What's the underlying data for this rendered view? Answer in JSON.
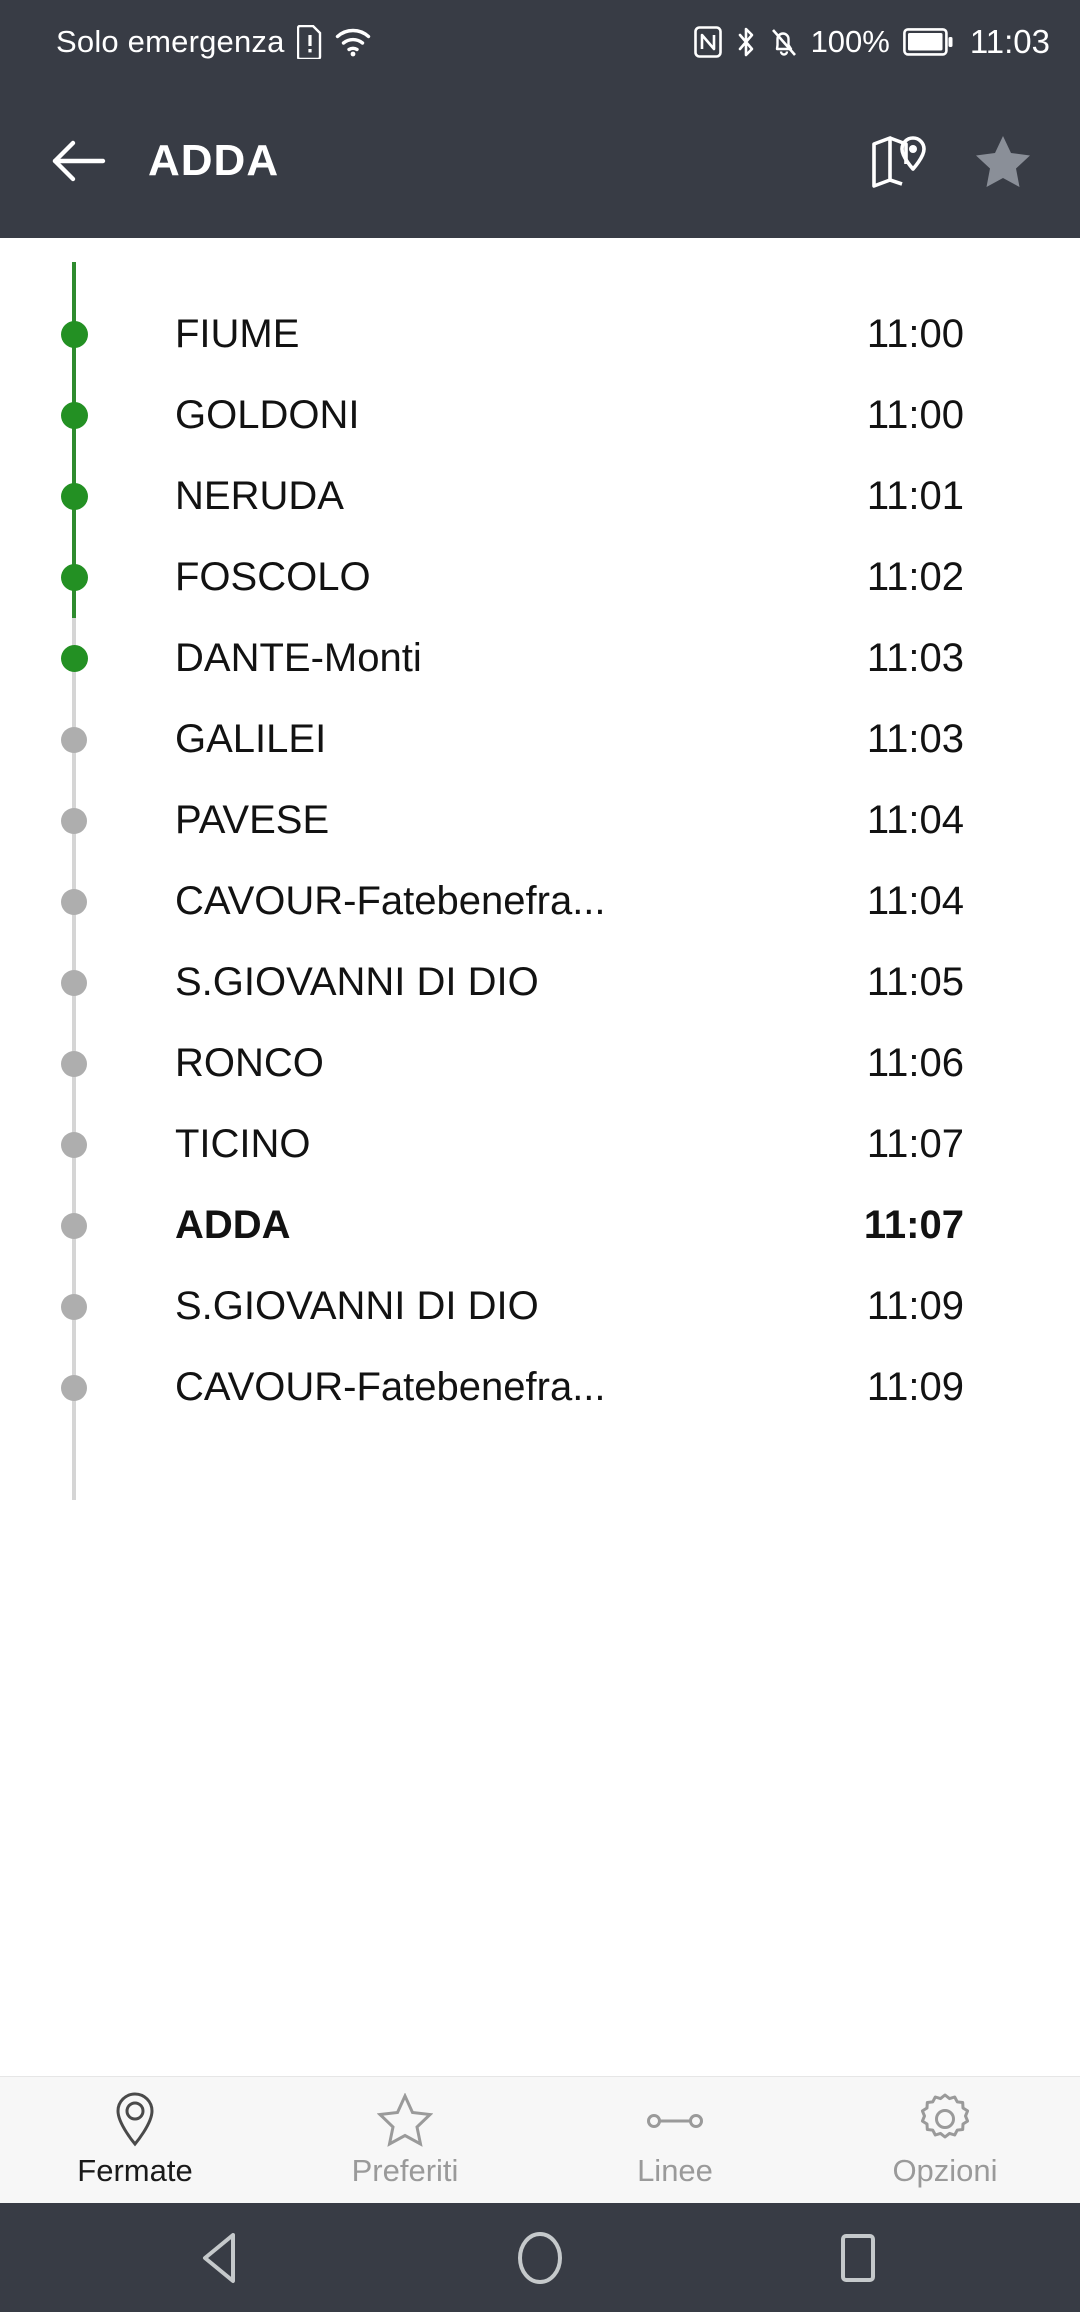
{
  "status_bar": {
    "carrier": "Solo emergenza",
    "battery_percent": "100%",
    "clock": "11:03",
    "icons": [
      "sim-alert-icon",
      "wifi-icon",
      "nfc-icon",
      "bluetooth-icon",
      "mute-bell-icon",
      "battery-icon"
    ],
    "background": "#383c45"
  },
  "app_bar": {
    "back_label": "back-arrow",
    "title": "ADDA",
    "map_action": "map-pin-icon",
    "favorite_action": "star-icon",
    "background": "#383c45",
    "title_color": "#ffffff",
    "star_color": "#8a8f98"
  },
  "timeline": {
    "passed_color": "#239023",
    "upcoming_color": "#aeaeae",
    "rail_passed_color": "#2e8b2e",
    "rail_upcoming_color": "#d5d5d5",
    "current_stop": "ADDA",
    "stops": [
      {
        "name": "FIUME",
        "time": "11:00",
        "state": "passed",
        "current": false
      },
      {
        "name": "GOLDONI",
        "time": "11:00",
        "state": "passed",
        "current": false
      },
      {
        "name": "NERUDA",
        "time": "11:01",
        "state": "passed",
        "current": false
      },
      {
        "name": "FOSCOLO",
        "time": "11:02",
        "state": "passed",
        "current": false
      },
      {
        "name": "DANTE-Monti",
        "time": "11:03",
        "state": "passed",
        "current": false
      },
      {
        "name": "GALILEI",
        "time": "11:03",
        "state": "upcoming",
        "current": false
      },
      {
        "name": "PAVESE",
        "time": "11:04",
        "state": "upcoming",
        "current": false
      },
      {
        "name": "CAVOUR-Fatebenefra...",
        "time": "11:04",
        "state": "upcoming",
        "current": false
      },
      {
        "name": "S.GIOVANNI DI DIO",
        "time": "11:05",
        "state": "upcoming",
        "current": false
      },
      {
        "name": "RONCO",
        "time": "11:06",
        "state": "upcoming",
        "current": false
      },
      {
        "name": "TICINO",
        "time": "11:07",
        "state": "upcoming",
        "current": false
      },
      {
        "name": "ADDA",
        "time": "11:07",
        "state": "upcoming",
        "current": true
      },
      {
        "name": "S.GIOVANNI DI DIO",
        "time": "11:09",
        "state": "upcoming",
        "current": false
      },
      {
        "name": "CAVOUR-Fatebenefra...",
        "time": "11:09",
        "state": "upcoming",
        "current": false
      }
    ]
  },
  "bottom_nav": {
    "background": "#f7f7f7",
    "items": [
      {
        "label": "Fermate",
        "icon": "location-pin-icon",
        "active": true
      },
      {
        "label": "Preferiti",
        "icon": "star-outline-icon",
        "active": false
      },
      {
        "label": "Linee",
        "icon": "line-route-icon",
        "active": false
      },
      {
        "label": "Opzioni",
        "icon": "gear-icon",
        "active": false
      }
    ]
  },
  "android_nav": {
    "background": "#383c45",
    "buttons": [
      "back-triangle-icon",
      "home-circle-icon",
      "recents-square-icon"
    ]
  }
}
